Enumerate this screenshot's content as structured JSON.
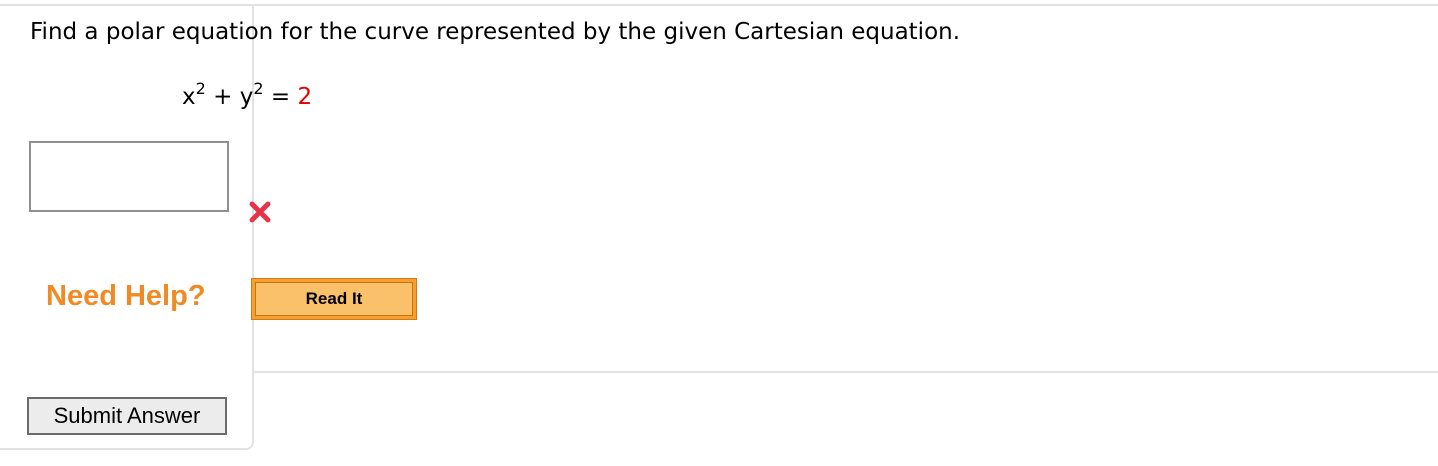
{
  "question": {
    "prompt": "Find a polar equation for the curve represented by the given Cartesian equation.",
    "equation": {
      "x_var": "x",
      "x_exp": "2",
      "plus": "+",
      "y_var": "y",
      "y_exp": "2",
      "equals": "=",
      "rhs": "2"
    },
    "answer": {
      "value": "",
      "status": "incorrect",
      "status_icon": "red-x-icon"
    }
  },
  "help": {
    "label": "Need Help?",
    "read_it_label": "Read It"
  },
  "actions": {
    "submit_label": "Submit Answer"
  },
  "colors": {
    "equation_rhs": "#e00000",
    "need_help": "#f08a24",
    "read_it_button": "#f5a030",
    "incorrect_mark": "#e8334a"
  }
}
